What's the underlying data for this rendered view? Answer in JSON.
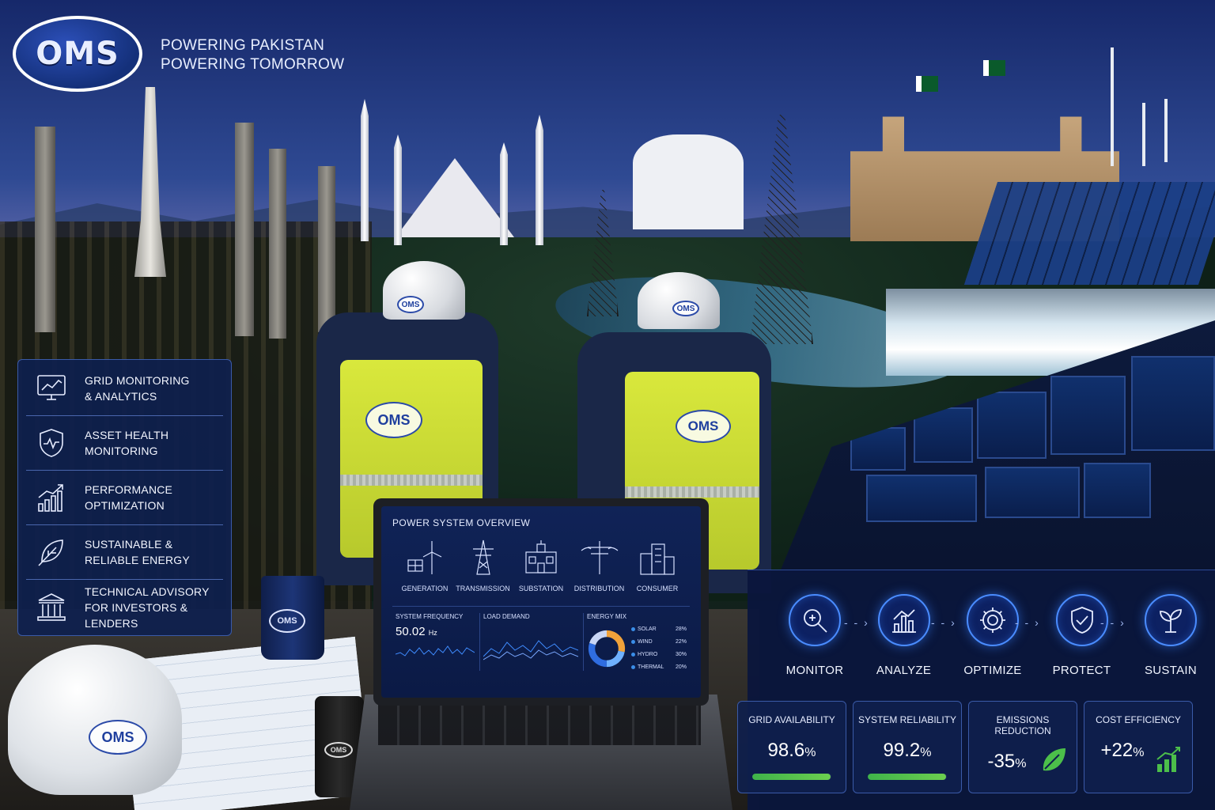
{
  "brand": {
    "logo_text": "OMS",
    "tagline_line1": "POWERING PAKISTAN",
    "tagline_line2": "POWERING TOMORROW"
  },
  "services": [
    {
      "icon": "analytics-monitor-icon",
      "line1": "GRID MONITORING",
      "line2": "& ANALYTICS"
    },
    {
      "icon": "shield-heartbeat-icon",
      "line1": "ASSET HEALTH",
      "line2": "MONITORING"
    },
    {
      "icon": "growth-chart-icon",
      "line1": "PERFORMANCE",
      "line2": "OPTIMIZATION"
    },
    {
      "icon": "leaf-icon",
      "line1": "SUSTAINABLE &",
      "line2": "RELIABLE ENERGY"
    },
    {
      "icon": "bank-building-icon",
      "line1": "TECHNICAL ADVISORY",
      "line2": "FOR INVESTORS & LENDERS"
    }
  ],
  "laptop": {
    "title": "POWER SYSTEM OVERVIEW",
    "chain": [
      "GENERATION",
      "TRANSMISSION",
      "SUBSTATION",
      "DISTRIBUTION",
      "CONSUMER"
    ],
    "frequency_label": "SYSTEM FREQUENCY",
    "frequency_value": "50.02",
    "frequency_unit": "Hz",
    "load_label": "LOAD DEMAND",
    "mix_label": "ENERGY MIX",
    "mix": [
      {
        "name": "SOLAR",
        "pct": "28%",
        "value": 28
      },
      {
        "name": "WIND",
        "pct": "22%",
        "value": 22
      },
      {
        "name": "HYDRO",
        "pct": "30%",
        "value": 30
      },
      {
        "name": "THERMAL",
        "pct": "20%",
        "value": 20
      }
    ]
  },
  "process": {
    "steps": [
      "MONITOR",
      "ANALYZE",
      "OPTIMIZE",
      "PROTECT",
      "SUSTAIN"
    ]
  },
  "kpis": [
    {
      "label": "GRID AVAILABILITY",
      "value": "98.6",
      "unit": "%",
      "fill": 0.986
    },
    {
      "label": "SYSTEM RELIABILITY",
      "value": "99.2",
      "unit": "%",
      "fill": 0.992
    },
    {
      "label": "EMISSIONS REDUCTION",
      "value": "-35",
      "unit": "%"
    },
    {
      "label": "COST EFFICIENCY",
      "value": "+22",
      "unit": "%"
    }
  ],
  "colors": {
    "panel": "#0e1f4e",
    "accent": "#4a8cff",
    "success": "#4cbf4a",
    "vest": "#d9e83c"
  }
}
